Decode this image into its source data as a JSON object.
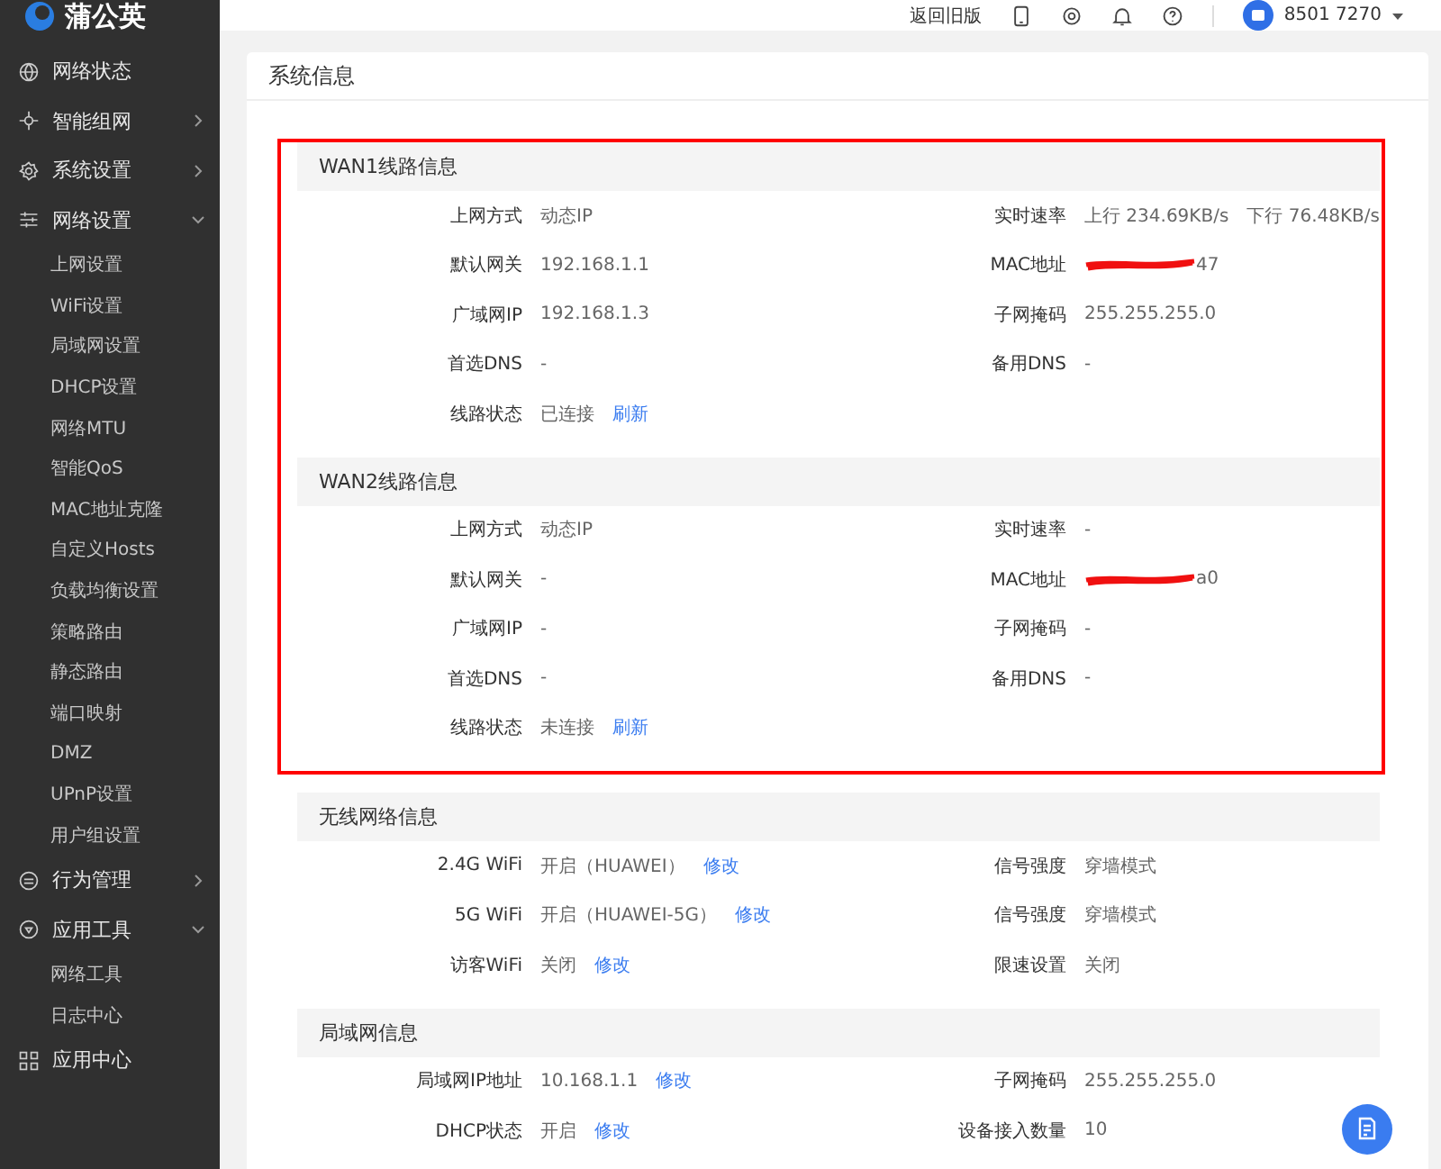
{
  "sidebar": {
    "logo": "蒲公英",
    "items": [
      {
        "label": "网络状态"
      },
      {
        "label": "智能组网",
        "expanded": false
      },
      {
        "label": "系统设置",
        "expanded": false
      },
      {
        "label": "网络设置",
        "expanded": true,
        "children": [
          {
            "label": "上网设置"
          },
          {
            "label": "WiFi设置"
          },
          {
            "label": "局域网设置"
          },
          {
            "label": "DHCP设置"
          },
          {
            "label": "网络MTU"
          },
          {
            "label": "智能QoS"
          },
          {
            "label": "MAC地址克隆"
          },
          {
            "label": "自定义Hosts"
          },
          {
            "label": "负载均衡设置"
          },
          {
            "label": "策略路由"
          },
          {
            "label": "静态路由"
          },
          {
            "label": "端口映射"
          },
          {
            "label": "DMZ"
          },
          {
            "label": "UPnP设置"
          },
          {
            "label": "用户组设置"
          }
        ]
      },
      {
        "label": "行为管理",
        "expanded": false
      },
      {
        "label": "应用工具",
        "expanded": true,
        "children": [
          {
            "label": "网络工具"
          },
          {
            "label": "日志中心"
          }
        ]
      },
      {
        "label": "应用中心"
      }
    ]
  },
  "header": {
    "back_link": "返回旧版",
    "user": "8501 7270"
  },
  "page": {
    "title": "系统信息",
    "sections": [
      {
        "title": "WAN1线路信息",
        "highlighted": true,
        "fields": [
          {
            "label": "上网方式",
            "value": "动态IP"
          },
          {
            "label": "实时速率",
            "values": [
              "上行 234.69KB/s",
              "下行 76.48KB/s"
            ]
          },
          {
            "label": "默认网关",
            "value": "192.168.1.1"
          },
          {
            "label": "MAC地址",
            "kind": "redacted",
            "value": "47"
          },
          {
            "label": "广域网IP",
            "value": "192.168.1.3"
          },
          {
            "label": "子网掩码",
            "value": "255.255.255.0"
          },
          {
            "label": "首选DNS",
            "value": "-"
          },
          {
            "label": "备用DNS",
            "value": "-"
          },
          {
            "label": "线路状态",
            "value": "已连接",
            "link": "刷新"
          }
        ]
      },
      {
        "title": "WAN2线路信息",
        "highlighted": true,
        "fields": [
          {
            "label": "上网方式",
            "value": "动态IP"
          },
          {
            "label": "实时速率",
            "value": "-"
          },
          {
            "label": "默认网关",
            "value": "-"
          },
          {
            "label": "MAC地址",
            "kind": "redacted",
            "value": "a0"
          },
          {
            "label": "广域网IP",
            "value": "-"
          },
          {
            "label": "子网掩码",
            "value": "-"
          },
          {
            "label": "首选DNS",
            "value": "-"
          },
          {
            "label": "备用DNS",
            "value": "-"
          },
          {
            "label": "线路状态",
            "value": "未连接",
            "link": "刷新"
          }
        ]
      },
      {
        "title": "无线网络信息",
        "highlighted": false,
        "fields": [
          {
            "label": "2.4G WiFi",
            "value": "开启（HUAWEI）",
            "link": "修改"
          },
          {
            "label": "信号强度",
            "value": "穿墙模式"
          },
          {
            "label": "5G WiFi",
            "value": "开启（HUAWEI-5G）",
            "link": "修改"
          },
          {
            "label": "信号强度",
            "value": "穿墙模式"
          },
          {
            "label": "访客WiFi",
            "value": "关闭",
            "link": "修改"
          },
          {
            "label": "限速设置",
            "value": "关闭"
          }
        ]
      },
      {
        "title": "局域网信息",
        "highlighted": false,
        "fields": [
          {
            "label": "局域网IP地址",
            "value": "10.168.1.1",
            "link": "修改"
          },
          {
            "label": "子网掩码",
            "value": "255.255.255.0"
          },
          {
            "label": "DHCP状态",
            "value": "开启",
            "link": "修改"
          },
          {
            "label": "设备接入数量",
            "value": "10"
          }
        ]
      }
    ]
  }
}
